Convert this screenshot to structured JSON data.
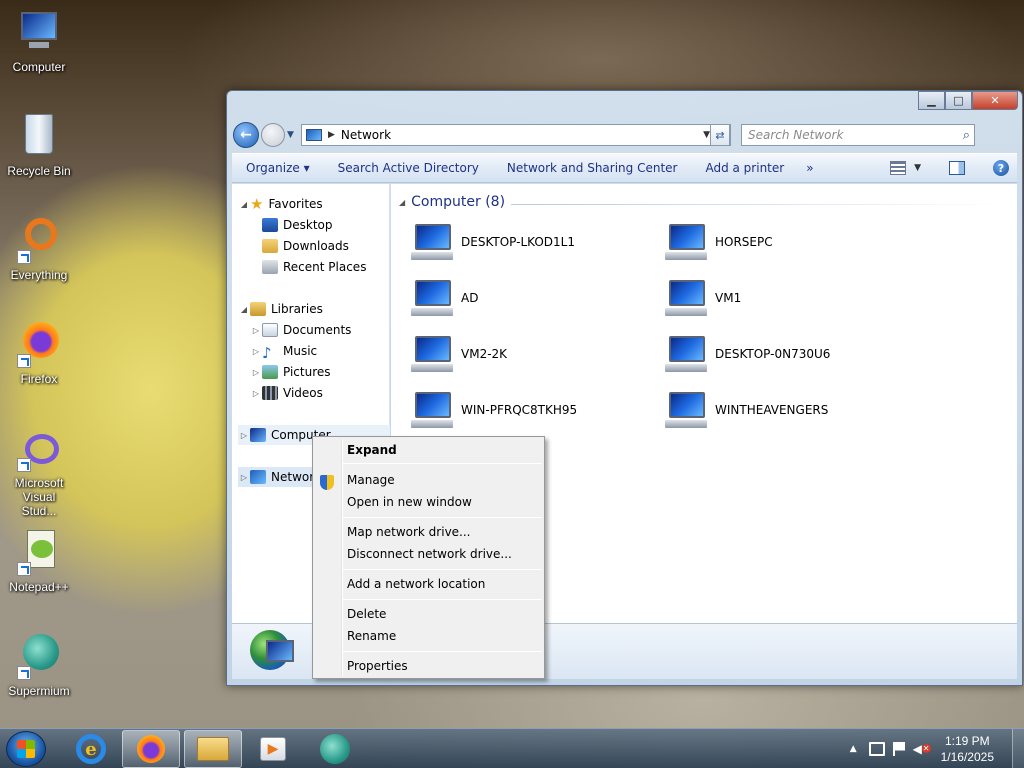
{
  "desktop": {
    "icons": [
      {
        "label": "Computer"
      },
      {
        "label": "Recycle Bin"
      },
      {
        "label": "Everything"
      },
      {
        "label": "Firefox"
      },
      {
        "label": "Microsoft Visual Stud..."
      },
      {
        "label": "Notepad++"
      },
      {
        "label": "Supermium"
      }
    ]
  },
  "window": {
    "address": "Network",
    "search_placeholder": "Search Network",
    "toolbar": {
      "organize": "Organize ▾",
      "search_ad": "Search Active Directory",
      "sharing_center": "Network and Sharing Center",
      "add_printer": "Add a printer",
      "more": "»"
    },
    "nav": {
      "favorites": "Favorites",
      "desktop": "Desktop",
      "downloads": "Downloads",
      "recent_places": "Recent Places",
      "libraries": "Libraries",
      "documents": "Documents",
      "music": "Music",
      "pictures": "Pictures",
      "videos": "Videos",
      "computer": "Computer",
      "network": "Network"
    },
    "group_header": "Computer (8)",
    "computers": [
      "DESKTOP-LKOD1L1",
      "HORSEPC",
      "AD",
      "VM1",
      "VM2-2K",
      "DESKTOP-0N730U6",
      "WIN-PFRQC8TKH95",
      "WINTHEAVENGERS"
    ]
  },
  "context_menu": {
    "expand": "Expand",
    "manage": "Manage",
    "open_new_window": "Open in new window",
    "map_drive": "Map network drive...",
    "disconnect_drive": "Disconnect network drive...",
    "add_location": "Add a network location",
    "delete": "Delete",
    "rename": "Rename",
    "properties": "Properties"
  },
  "taskbar": {
    "time": "1:19 PM",
    "date": "1/16/2025"
  },
  "colors": {
    "link_blue": "#1e3287",
    "accent": "#1e5fb8"
  }
}
